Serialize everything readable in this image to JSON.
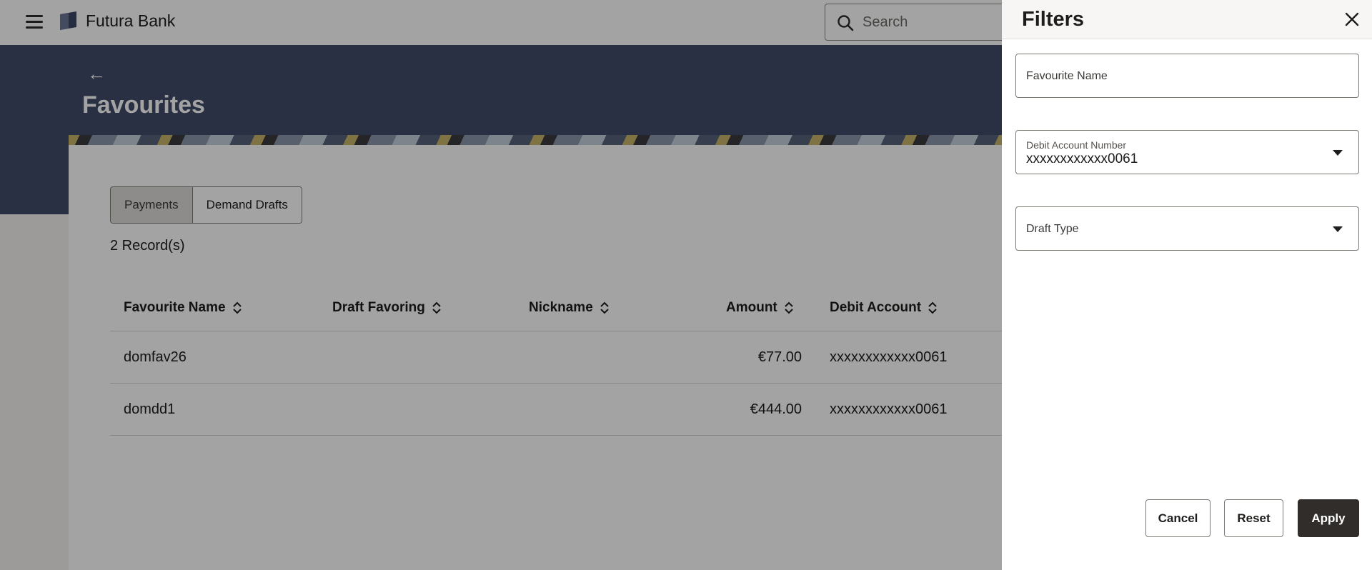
{
  "header": {
    "brand": "Futura Bank",
    "search_placeholder": "Search"
  },
  "page": {
    "title": "Favourites",
    "tabs": [
      {
        "label": "Payments",
        "active": true
      },
      {
        "label": "Demand Drafts",
        "active": false
      }
    ],
    "record_count": "2 Record(s)"
  },
  "table": {
    "columns": [
      "Favourite Name",
      "Draft Favoring",
      "Nickname",
      "Amount",
      "Debit Account"
    ],
    "rows": [
      {
        "name": "domfav26",
        "favoring": "",
        "nickname": "",
        "amount": "€77.00",
        "account": "xxxxxxxxxxxx0061"
      },
      {
        "name": "domdd1",
        "favoring": "",
        "nickname": "",
        "amount": "€444.00",
        "account": "xxxxxxxxxxxx0061"
      }
    ]
  },
  "filters": {
    "title": "Filters",
    "favourite_name": {
      "label": "Favourite Name",
      "value": ""
    },
    "debit_account": {
      "label": "Debit Account Number",
      "value": "xxxxxxxxxxxx0061"
    },
    "draft_type": {
      "label": "Draft Type",
      "value": ""
    },
    "buttons": {
      "cancel": "Cancel",
      "reset": "Reset",
      "apply": "Apply"
    }
  },
  "colors": {
    "hero": "#434b6b",
    "primary_button": "#312d2a"
  }
}
